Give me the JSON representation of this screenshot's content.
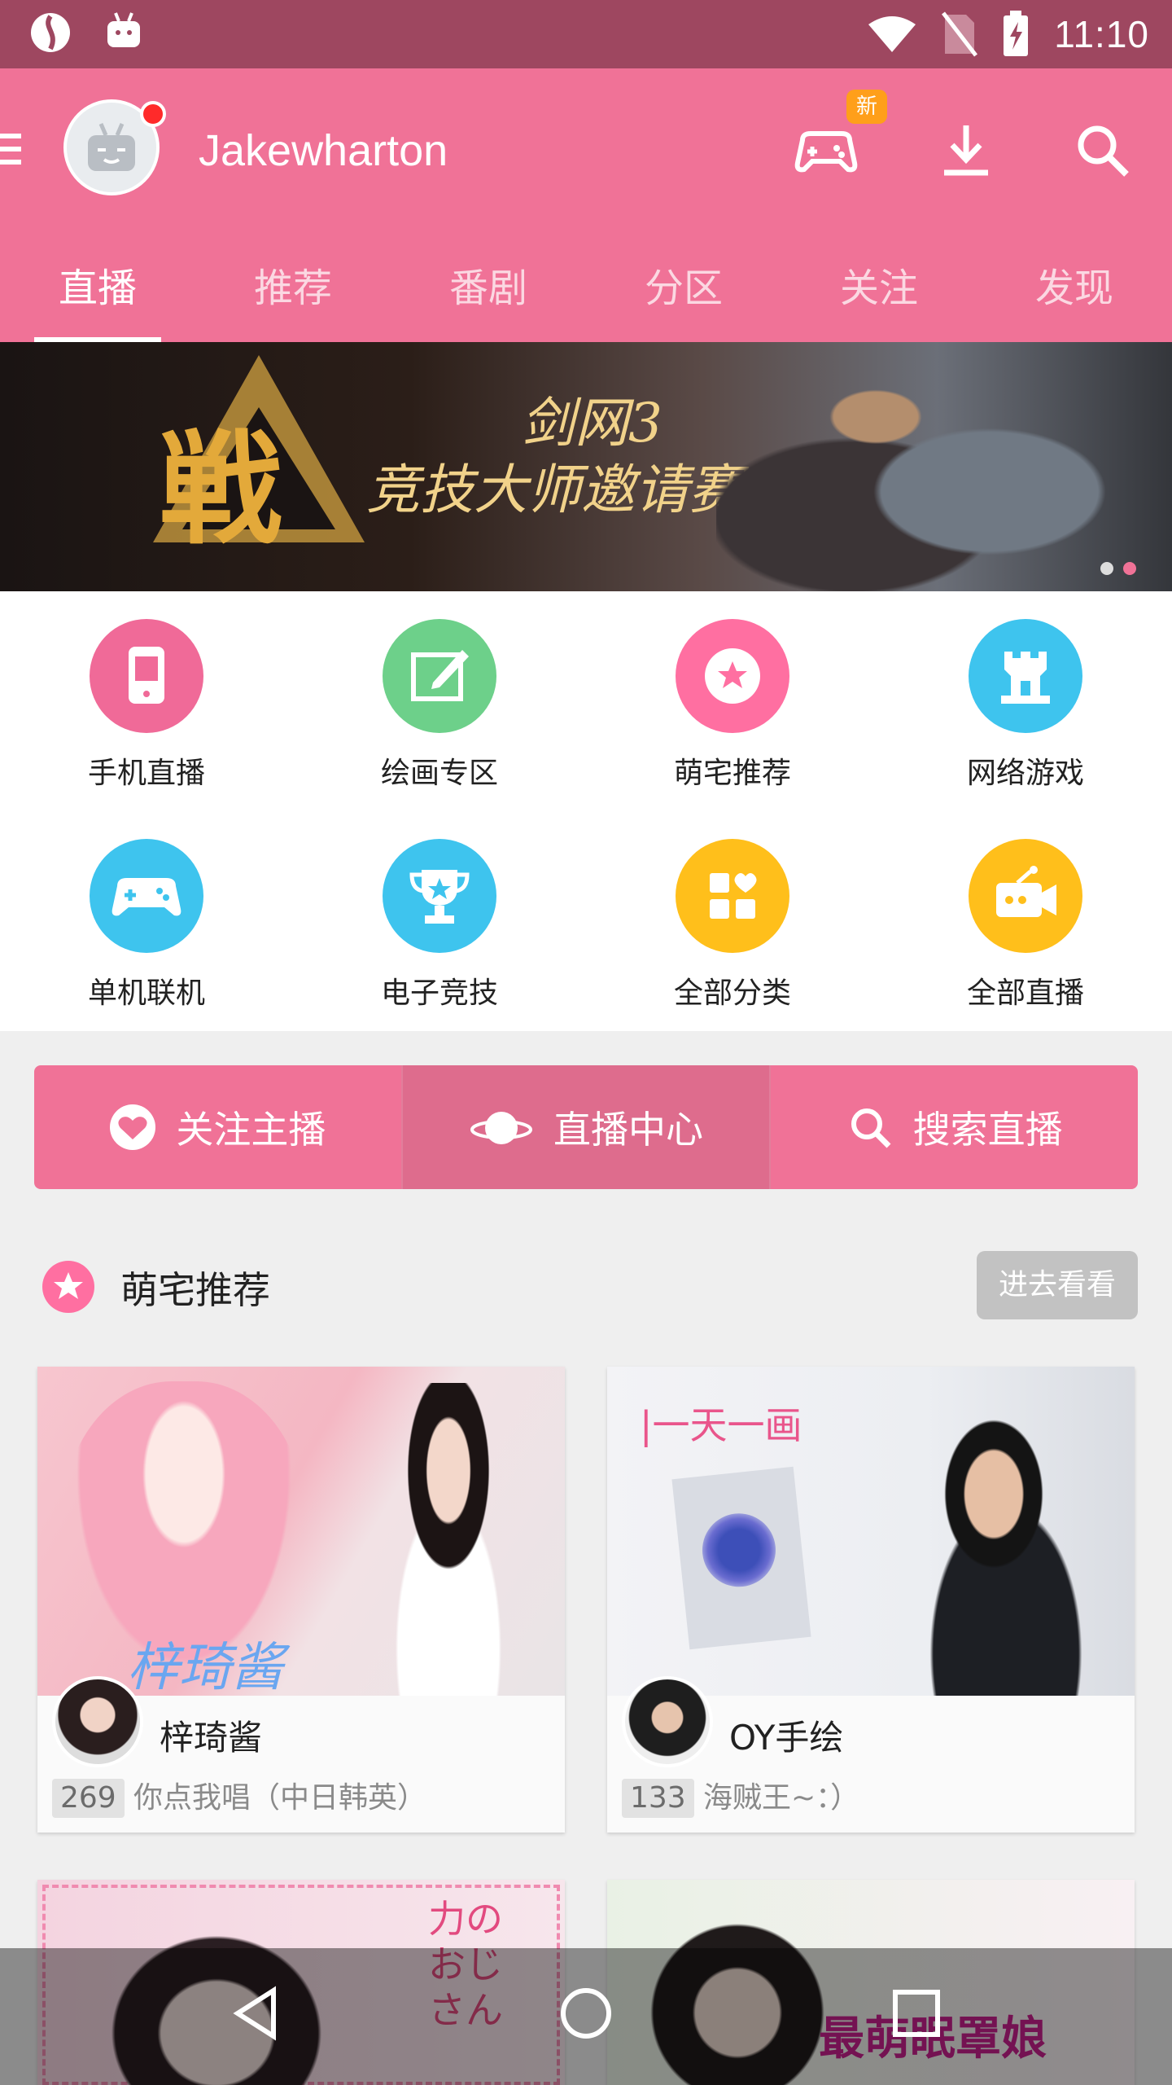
{
  "status_bar": {
    "time": "11:10"
  },
  "header": {
    "username": "Jakewharton",
    "new_badge": "新"
  },
  "tabs": [
    {
      "label": "直播"
    },
    {
      "label": "推荐"
    },
    {
      "label": "番剧"
    },
    {
      "label": "分区"
    },
    {
      "label": "关注"
    },
    {
      "label": "发现"
    }
  ],
  "banner": {
    "big_char": "戦",
    "line1": "剑网3",
    "line2": "竞技大师邀请赛"
  },
  "categories": [
    {
      "label": "手机直播",
      "color": "#f06a98",
      "icon": "phone-icon"
    },
    {
      "label": "绘画专区",
      "color": "#6dd08a",
      "icon": "paint-icon"
    },
    {
      "label": "萌宅推荐",
      "color": "#ff6fa1",
      "icon": "star-badge-icon"
    },
    {
      "label": "网络游戏",
      "color": "#3ec4ee",
      "icon": "castle-icon"
    },
    {
      "label": "单机联机",
      "color": "#3ec4ee",
      "icon": "gamepad-icon"
    },
    {
      "label": "电子竞技",
      "color": "#3ec4ee",
      "icon": "trophy-icon"
    },
    {
      "label": "全部分类",
      "color": "#ffbf1b",
      "icon": "grid-icon"
    },
    {
      "label": "全部直播",
      "color": "#ffbf1b",
      "icon": "camera-icon"
    }
  ],
  "actions": [
    {
      "label": "关注主播"
    },
    {
      "label": "直播中心"
    },
    {
      "label": "搜索直播"
    }
  ],
  "section": {
    "title": "萌宅推荐",
    "more": "进去看看"
  },
  "cards": [
    {
      "name": "梓琦酱",
      "count": "269",
      "desc": "你点我唱（中日韩英）",
      "thumb_text": "梓琦酱"
    },
    {
      "name": "OY手绘",
      "count": "133",
      "desc": "海贼王~：）",
      "thumb_text": "|一天一画"
    },
    {
      "name": "",
      "count": "",
      "desc": "",
      "thumb_text": "力のおじさん"
    },
    {
      "name": "",
      "count": "",
      "desc": "",
      "thumb_text": "最萌眠罩娘"
    }
  ],
  "colors": {
    "primary": "#f07297",
    "status_bar": "#9e4760"
  }
}
